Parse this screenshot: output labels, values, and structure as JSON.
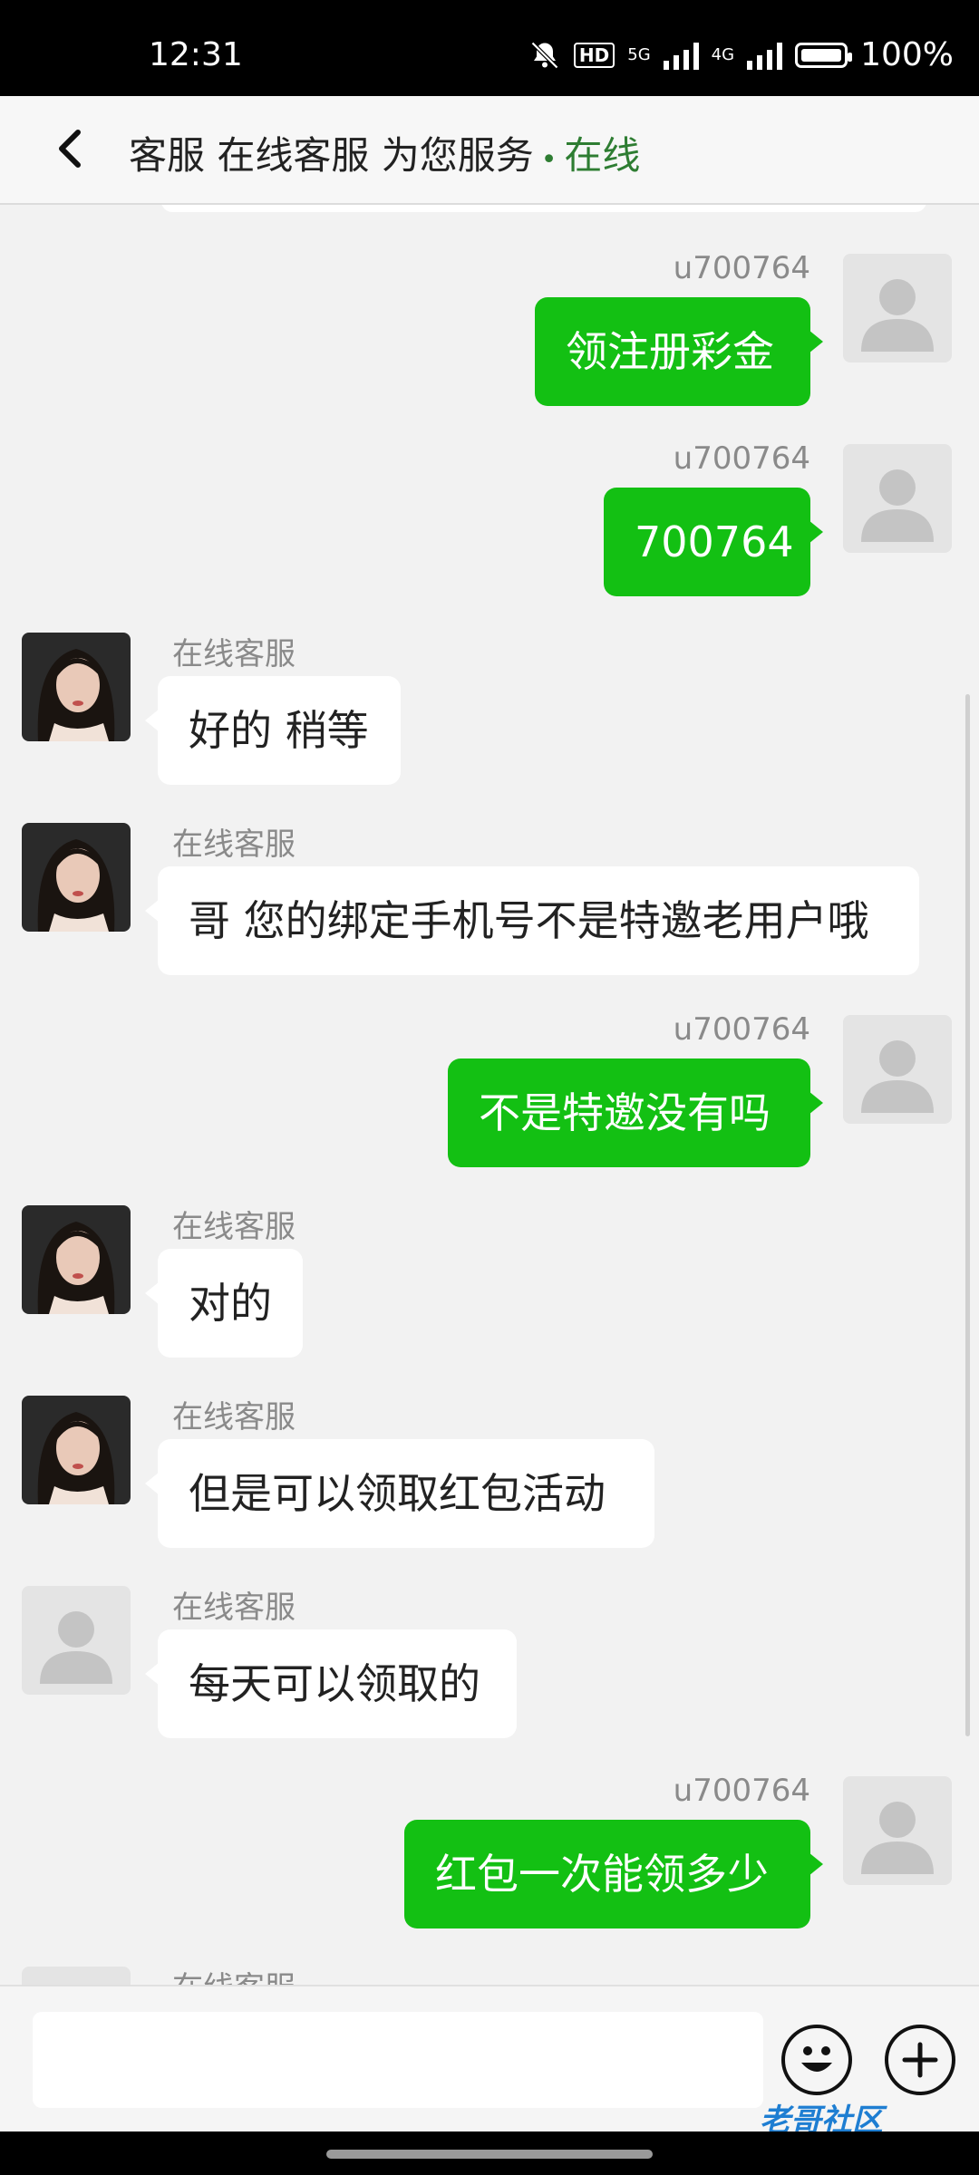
{
  "status_bar": {
    "time": "12:31",
    "battery": "100%",
    "hd_label": "HD",
    "net1": "5G",
    "net2": "4G"
  },
  "header": {
    "back_label": "back",
    "title": "客服 在线客服 为您服务",
    "dot": "•",
    "status": "在线"
  },
  "messages": [
    {
      "side": "out",
      "name": "u700764",
      "text": "领注册彩金"
    },
    {
      "side": "out",
      "name": "u700764",
      "text": "700764"
    },
    {
      "side": "in",
      "name": "在线客服",
      "text": "好的 稍等",
      "avatar": "photo"
    },
    {
      "side": "in",
      "name": "在线客服",
      "text": "哥 您的绑定手机号不是特邀老用户哦",
      "avatar": "photo"
    },
    {
      "side": "out",
      "name": "u700764",
      "text": "不是特邀没有吗"
    },
    {
      "side": "in",
      "name": "在线客服",
      "text": "对的",
      "avatar": "photo"
    },
    {
      "side": "in",
      "name": "在线客服",
      "text": "但是可以领取红包活动",
      "avatar": "photo"
    },
    {
      "side": "in",
      "name": "在线客服",
      "text": "每天可以领取的",
      "avatar": "placeholder"
    },
    {
      "side": "out",
      "name": "u700764",
      "text": "红包一次能领多少"
    },
    {
      "side": "in",
      "name": "在线客服",
      "text": "",
      "avatar": "placeholder"
    }
  ],
  "input": {
    "placeholder": ""
  },
  "watermark": "老哥社区",
  "colors": {
    "outgoing_bubble": "#13c013",
    "incoming_bubble": "#ffffff",
    "online_status": "#2e7d32"
  }
}
